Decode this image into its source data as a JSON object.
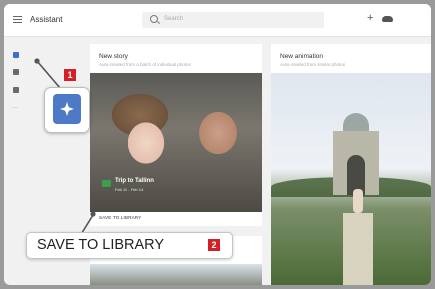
{
  "header": {
    "app_title": "Assistant",
    "search_placeholder": "Search"
  },
  "sidebar": {
    "more_label": "..."
  },
  "cards": {
    "new_story": {
      "title": "New story",
      "subtitle": "Auto-created from a batch of individual photos",
      "trip_title": "Trip to Tallinn",
      "trip_dates": "Feb 11 - Feb 14",
      "save_label": "SAVE TO LIBRARY"
    },
    "new_animation": {
      "title": "New animation",
      "subtitle": "Auto-created from similar photos"
    }
  },
  "annotations": {
    "badge_1": "1",
    "callout_text": "SAVE TO LIBRARY",
    "badge_2": "2"
  },
  "colors": {
    "accent": "#4e79c6",
    "badge": "#d41f26",
    "trip_icon": "#3aa04a"
  },
  "icons": [
    "menu-icon",
    "search-icon",
    "add-icon",
    "cloud-icon",
    "assistant-icon",
    "photos-icon",
    "albums-icon"
  ]
}
